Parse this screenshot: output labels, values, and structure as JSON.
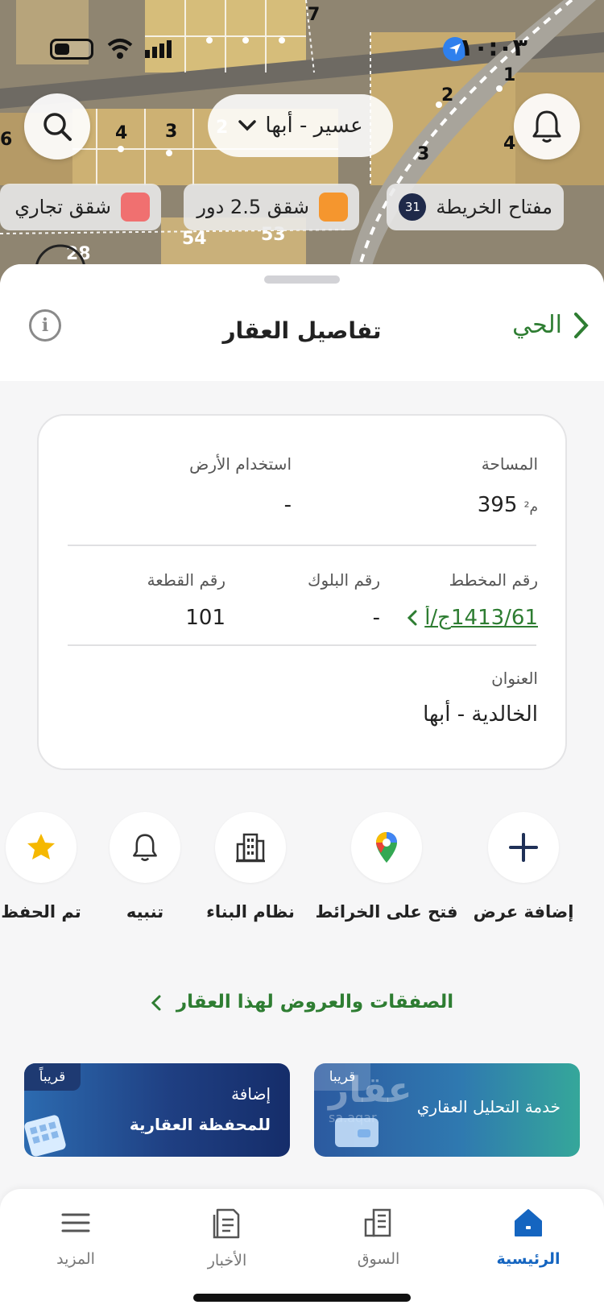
{
  "status_bar": {
    "time": "١٠:٠٣"
  },
  "map": {
    "region_selector": "عسير - أبها",
    "legend": [
      {
        "label": "مفتاح الخريطة",
        "badge": "31"
      },
      {
        "label": "شقق 2.5 دور",
        "color": "#f5962e"
      },
      {
        "label": "شقق تجاري",
        "color": "#f07070"
      }
    ],
    "parcel_numbers": [
      "1",
      "2",
      "3",
      "4",
      "4",
      "3",
      "2",
      "6",
      "54",
      "53",
      "28",
      "7"
    ]
  },
  "sheet": {
    "title": "تفاصيل العقار",
    "back_label": "الحي"
  },
  "details": {
    "area_label": "المساحة",
    "area_value": "395",
    "area_unit": "م²",
    "land_use_label": "استخدام الأرض",
    "land_use_value": "-",
    "plan_number_label": "رقم المخطط",
    "plan_number_value": "1413/61ج/أ",
    "block_number_label": "رقم البلوك",
    "block_number_value": "-",
    "parcel_number_label": "رقم القطعة",
    "parcel_number_value": "101",
    "address_label": "العنوان",
    "address_value": "الخالدية - أبها"
  },
  "actions": [
    {
      "label": "إضافة عرض",
      "icon": "plus-icon"
    },
    {
      "label": "فتح على الخرائط",
      "icon": "map-pin-icon"
    },
    {
      "label": "نظام البناء",
      "icon": "building-icon"
    },
    {
      "label": "تنبيه",
      "icon": "bell-icon"
    },
    {
      "label": "تم الحفظ",
      "icon": "star-icon"
    }
  ],
  "deals_link": "الصفقات والعروض لهذا العقار",
  "promos": [
    {
      "title": "خدمة التحليل العقاري",
      "tag": "قريبا",
      "watermark": "عقار",
      "watermark_sub": "sa.aqar"
    },
    {
      "title_line1": "إضافة",
      "title_line2": "للمحفظة العقارية",
      "tag": "قريباً"
    }
  ],
  "tabbar": [
    {
      "label": "الرئيسية",
      "icon": "home-icon",
      "active": true
    },
    {
      "label": "السوق",
      "icon": "market-icon",
      "active": false
    },
    {
      "label": "الأخبار",
      "icon": "news-icon",
      "active": false
    },
    {
      "label": "المزيد",
      "icon": "menu-icon",
      "active": false
    }
  ],
  "colors": {
    "accent_green": "#2e7d32",
    "active_blue": "#1565c0",
    "legend_orange": "#f5962e",
    "legend_red": "#f07070"
  }
}
